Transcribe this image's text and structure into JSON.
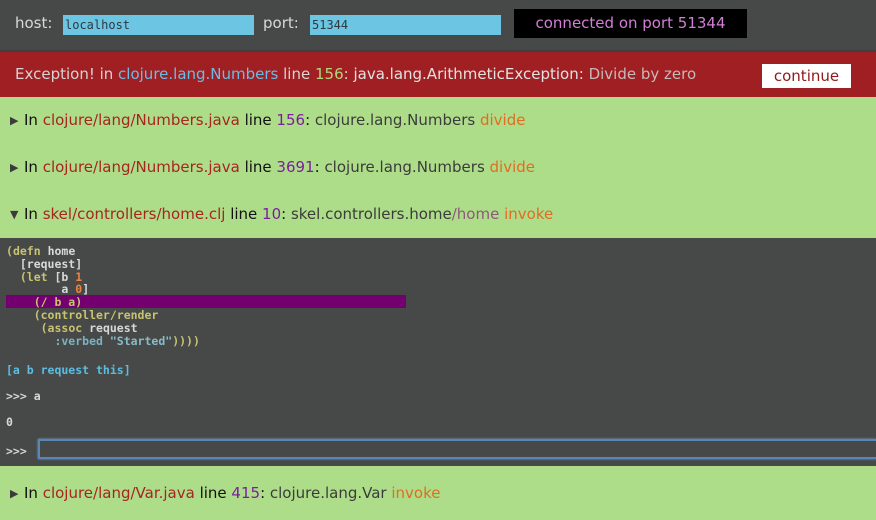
{
  "connection": {
    "host_label": "host:",
    "host_value": "localhost",
    "port_label": "port:",
    "port_value": "51344",
    "status_text": "connected on port 51344"
  },
  "exception": {
    "prefix": "Exception! in ",
    "class_name": "clojure.lang.Numbers",
    "line_word": " line ",
    "line_number": "156",
    "colon": ": ",
    "exception_type": "java.lang.ArithmeticException:",
    "message": " Divide by zero",
    "continue_label": "continue"
  },
  "frames": [
    {
      "expanded": false,
      "toggle_icon": "▶",
      "in_word": "In ",
      "file": "clojure/lang/Numbers.java",
      "line_word": " line ",
      "line": "156",
      "colon": ": ",
      "namespace": "clojure.lang.Numbers",
      "fn": "",
      "method": " divide"
    },
    {
      "expanded": false,
      "toggle_icon": "▶",
      "in_word": "In ",
      "file": "clojure/lang/Numbers.java",
      "line_word": " line ",
      "line": "3691",
      "colon": ": ",
      "namespace": "clojure.lang.Numbers",
      "fn": "",
      "method": " divide"
    },
    {
      "expanded": true,
      "toggle_icon": "▼",
      "in_word": "In ",
      "file": "skel/controllers/home.clj",
      "line_word": " line ",
      "line": "10",
      "colon": ": ",
      "namespace": "skel.controllers.home",
      "fn": "/home",
      "method": " invoke"
    },
    {
      "expanded": false,
      "toggle_icon": "▶",
      "in_word": "In ",
      "file": "clojure/lang/Var.java",
      "line_word": " line ",
      "line": "415",
      "colon": ": ",
      "namespace": "clojure.lang.Var",
      "fn": "",
      "method": " invoke"
    }
  ],
  "source": {
    "lines": {
      "l1_open": "(",
      "l1_defn": "defn",
      "l1_name": " home",
      "l2": "  [request]",
      "l3_open": "  (",
      "l3_let": "let",
      "l3_rest": " [b ",
      "l3_num": "1",
      "l4_rest": "        a ",
      "l4_num": "0",
      "l4_close": "]",
      "l5": "    (/ b a)",
      "l6": "    (controller/render",
      "l7_open": "     (",
      "l7_assoc": "assoc",
      "l7_rest": " request",
      "l8_kw": "       :verbed",
      "l8_str": " \"Started\"",
      "l8_close": "))))"
    },
    "highlighted_line": 5
  },
  "repl": {
    "locals": "[a b request this]",
    "history_input": ">>> a",
    "history_output": "0",
    "prompt": ">>>",
    "input_value": ""
  }
}
